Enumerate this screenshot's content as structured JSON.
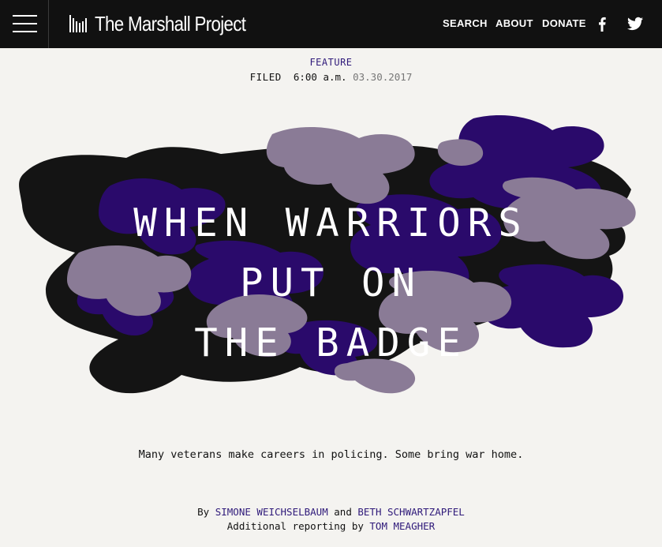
{
  "header": {
    "logo_text": "The Marshall Project",
    "nav": {
      "search": "SEARCH",
      "about": "ABOUT",
      "donate": "DONATE"
    },
    "social": [
      "facebook-icon",
      "twitter-icon"
    ],
    "bg_color": "#111111"
  },
  "article": {
    "kicker": "FEATURE",
    "filed_label": "FILED",
    "filed_time": "6:00 a.m.",
    "filed_date": "03.30.2017",
    "headline": {
      "line1": "WHEN WARRIORS",
      "line2": "PUT ON",
      "line3": "THE BADGE"
    },
    "dek": "Many veterans make careers in policing. Some bring war home.",
    "byline": {
      "by": "By",
      "author1": "SIMONE WEICHSELBAUM",
      "and": "and",
      "author2": "BETH SCHWARTZAPFEL",
      "additional_label": "Additional reporting by",
      "author3": "TOM MEAGHER"
    },
    "camo_colors": {
      "black": "#141414",
      "purple": "#2a0a6b",
      "mauve": "#8a7b96"
    },
    "accent_color": "#2f1a7a"
  }
}
